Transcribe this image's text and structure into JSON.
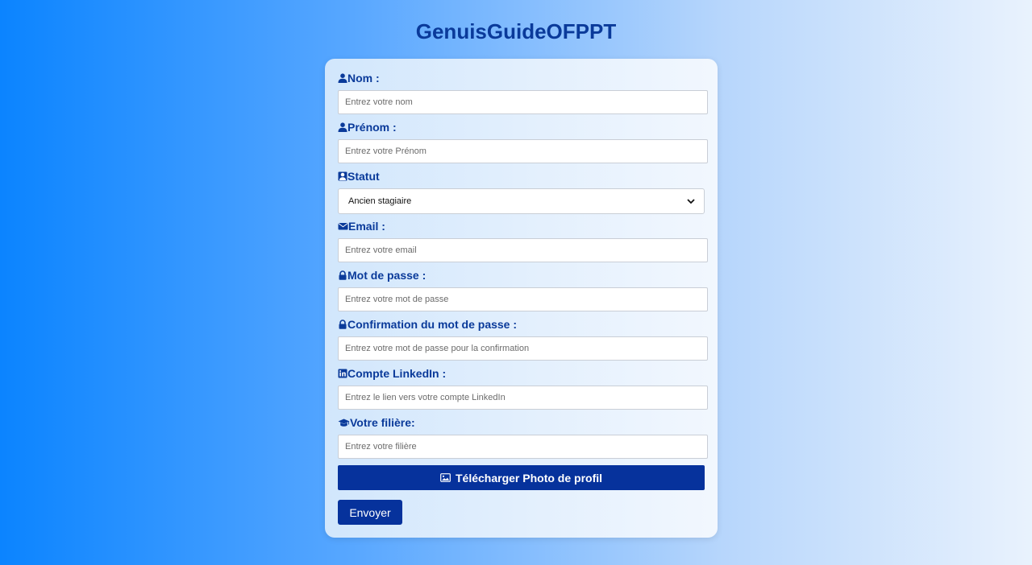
{
  "app": {
    "title": "GenuisGuideOFPPT"
  },
  "form": {
    "nom": {
      "label": "Nom :",
      "placeholder": "Entrez votre nom",
      "icon": "user-icon"
    },
    "prenom": {
      "label": "Prénom :",
      "placeholder": "Entrez votre Prénom",
      "icon": "user-icon"
    },
    "statut": {
      "label": "Statut",
      "value": "Ancien stagiaire",
      "icon": "user-tie-icon"
    },
    "email": {
      "label": "Email :",
      "placeholder": "Entrez votre email",
      "icon": "envelope-icon"
    },
    "password": {
      "label": "Mot de passe :",
      "placeholder": "Entrez votre mot de passe",
      "icon": "lock-icon"
    },
    "confirm": {
      "label": "Confirmation du mot de passe :",
      "placeholder": "Entrez votre mot de passe pour la confirmation",
      "icon": "lock-icon"
    },
    "linkedin": {
      "label": "Compte LinkedIn :",
      "placeholder": "Entrez le lien vers votre compte LinkedIn",
      "icon": "linkedin-icon"
    },
    "filiere": {
      "label": "Votre filière:",
      "placeholder": "Entrez votre filière",
      "icon": "graduation-cap-icon"
    },
    "upload_label": "Télécharger Photo de profil",
    "submit_label": "Envoyer"
  },
  "colors": {
    "primary": "#06329c",
    "label": "#0a3a9a",
    "background_start": "#0b84ff",
    "background_end": "#e9f2fd"
  }
}
